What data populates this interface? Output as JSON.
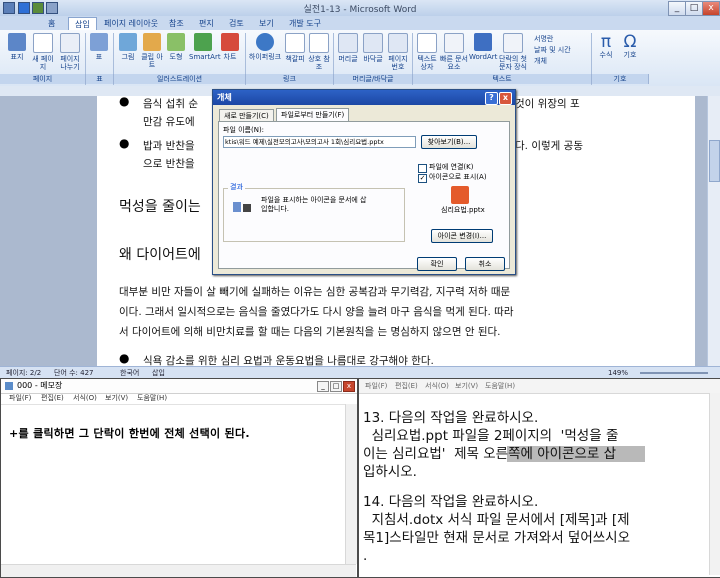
{
  "word": {
    "title": "실전1-13 - Microsoft Word",
    "tabs": [
      "홈",
      "삽입",
      "페이지 레이아웃",
      "참조",
      "편지",
      "검토",
      "보기",
      "개발 도구"
    ],
    "ribbon_buttons": [
      "표지",
      "새 페이지",
      "페이지 나누기",
      "표",
      "그림",
      "클립 아트",
      "도형",
      "SmartArt",
      "차트",
      "하이퍼링크",
      "책갈피",
      "상호 참조",
      "머리글",
      "바닥글",
      "페이지 번호",
      "텍스트 상자",
      "빠른 문서 요소",
      "WordArt",
      "단락의 첫 문자 장식",
      "서명란",
      "날짜 및 시간",
      "개체",
      "수식",
      "기호"
    ],
    "ribbon_groups": [
      "페이지",
      "표",
      "일러스트레이션",
      "링크",
      "머리글/바닥글",
      "텍스트",
      "기호"
    ],
    "doc": {
      "bullet1_a": "음식 섭취 순",
      "bullet1_b": "것이 위장의 포",
      "bullet1_c": "만감 유도에",
      "bullet2_a": "밥과 반찬을",
      "bullet2_b": "다. 이렇게 공동",
      "bullet2_c": "으로 반찬을",
      "heading1": "먹성을 줄이는",
      "heading2": "왜 다이어트에",
      "para": [
        "대부분 비만 자들이 살 빼기에 실패하는 이유는 심한 공복감과 무기력감, 지구력 저하 때문",
        "이다. 그래서 일시적으로는 음식을 줄였다가도 다시 양을 늘려 마구 음식을 먹게 된다. 따라",
        "서 다이어트에 의해 비만치료를 할 때는 다음의 기본원칙을 는 명심하지 않으면 안 된다."
      ],
      "bullet3": "식욕 감소를 위한 심리 요법과 운동요법을 나름대로 강구해야 한다."
    },
    "status": {
      "page": "페이지: 2/2",
      "words": "단어 수: 427",
      "lang": "한국어",
      "mode": "삽입",
      "zoom": "149%"
    }
  },
  "dialog": {
    "title": "개체",
    "tab_new": "새로 만들기(C)",
    "tab_file": "파일로부터 만들기(F)",
    "filename_label": "파일 이름(N):",
    "filename_value": "ktis\\워드 예제\\실전모의고사\\모의고사 1회\\심리요법.pptx",
    "browse": "찾아보기(B)...",
    "link_label": "파일에 연결(K)",
    "icon_label": "아이콘으로 표시(A)",
    "result_label": "결과",
    "result_text": "파일을 표시하는 아이콘을 문서에 삽입합니다.",
    "icon_caption": "심리요법.pptx",
    "change_icon": "아이콘 변경(I)...",
    "ok": "확인",
    "cancel": "취소"
  },
  "notepad": {
    "title": "000 - 메모장",
    "menu": [
      "파일(F)",
      "편집(E)",
      "서식(O)",
      "보기(V)",
      "도움말(H)"
    ],
    "text": "+를 클릭하면 그 단락이 한번에 전체 선택이 된다."
  },
  "rightdoc": {
    "menu": [
      "파일(F)",
      "편집(E)",
      "서식(O)",
      "보기(V)",
      "도움말(H)"
    ],
    "lines": [
      "13. 다음의 작업을 완료하시오.",
      "  심리요법.ppt 파일을 2페이지의  '먹성을 줄",
      "이는 심리요법'  제목 오른쪽에 아이콘으로 삽",
      "입하시오.",
      "",
      "14. 다음의 작업을 완료하시오.",
      "  지침서.dotx 서식 파일 문서에서 [제목]과 [제",
      "목1]스타일만 현재 문서로 가져와서 덮어쓰시오",
      "."
    ]
  }
}
